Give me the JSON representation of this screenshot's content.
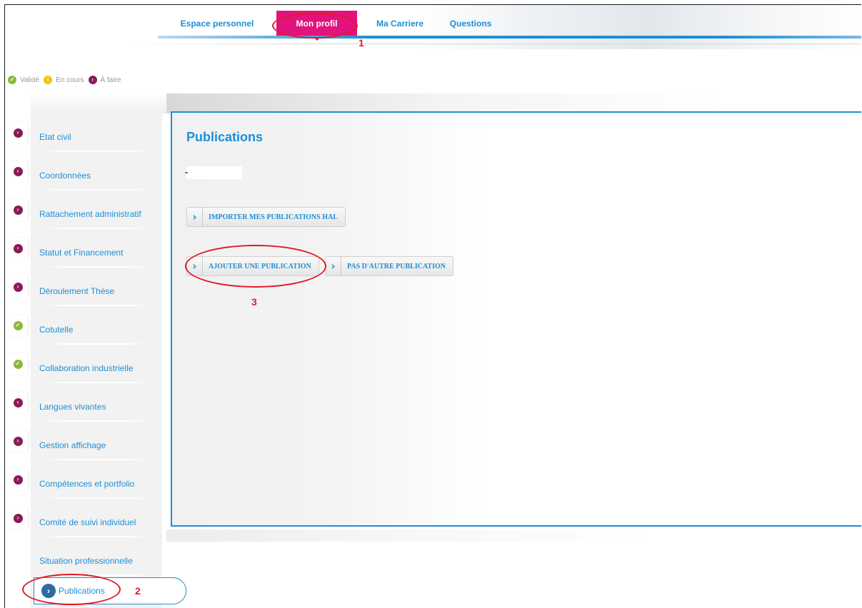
{
  "nav": {
    "tabs": [
      {
        "label": "Espace personnel"
      },
      {
        "label": "Mon profil",
        "active": true
      },
      {
        "label": "Ma Carriere"
      },
      {
        "label": "Questions"
      }
    ]
  },
  "legend": {
    "valide": "Validé",
    "en_cours": "En cours",
    "a_faire": "À faire"
  },
  "sidebar": {
    "items": [
      {
        "label": "Etat civil",
        "status": "a-faire"
      },
      {
        "label": "Coordonnées",
        "status": "a-faire"
      },
      {
        "label": "Rattachement administratif",
        "status": "a-faire"
      },
      {
        "label": "Statut et Financement",
        "status": "a-faire"
      },
      {
        "label": "Déroulement Thèse",
        "status": "a-faire"
      },
      {
        "label": "Cotutelle",
        "status": "valide"
      },
      {
        "label": "Collaboration industrielle",
        "status": "valide"
      },
      {
        "label": "Langues vivantes",
        "status": "a-faire"
      },
      {
        "label": "Gestion affichage",
        "status": "a-faire"
      },
      {
        "label": "Compétences et portfolio",
        "status": "a-faire"
      },
      {
        "label": "Comité de suivi individuel",
        "status": "a-faire"
      },
      {
        "label": "Situation professionnelle",
        "status": "none"
      },
      {
        "label": "Publications",
        "status": "active"
      }
    ]
  },
  "main": {
    "title": "Publications",
    "buttons": {
      "import": "IMPORTER MES PUBLICATIONS HAL",
      "add": "AJOUTER UNE PUBLICATION",
      "none": "PAS D'AUTRE PUBLICATION"
    }
  },
  "annotations": {
    "n1": "1",
    "n2": "2",
    "n3": "3"
  },
  "colors": {
    "accent": "#1c8fd6",
    "active_tab": "#e2137c",
    "valide": "#8cb93a",
    "en_cours": "#f0c313",
    "a_faire": "#8b1a57",
    "annotation": "#e01b24"
  }
}
